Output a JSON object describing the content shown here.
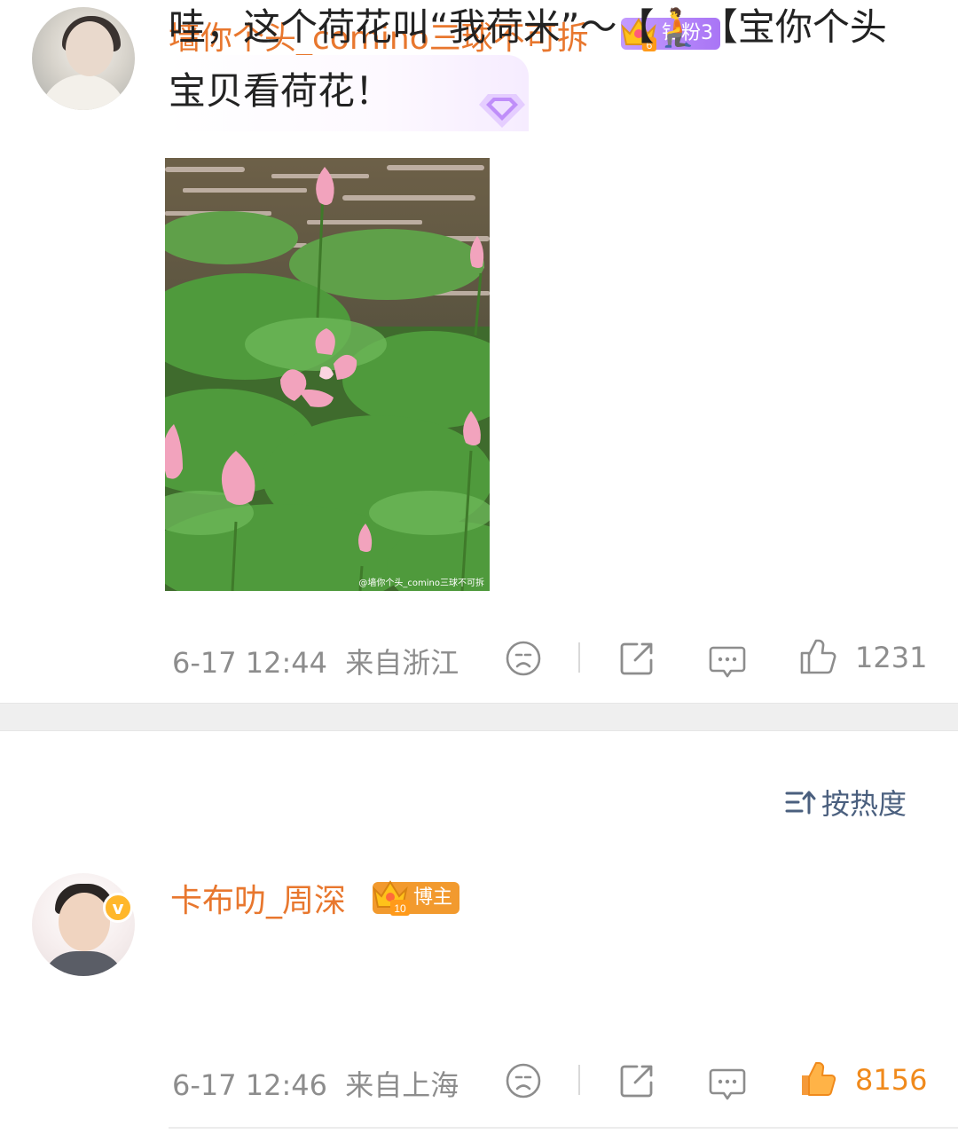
{
  "comments": [
    {
      "username": "墙你个头_comino三球不可拆",
      "badge": "钻粉3",
      "badge_level": "6",
      "text": "宝贝看荷花！",
      "image_watermark": "@墙你个头_comino三球不可拆",
      "timestamp": "6-17 12:44",
      "location": "来自浙江",
      "like_count": "1231",
      "liked": false
    },
    {
      "username": "卡布叻_周深",
      "badge": "博主",
      "badge_level": "10",
      "verified_mark": "v",
      "text": "哇，这个荷花叫“我荷米”～【🧎【宝你个头",
      "timestamp": "6-17 12:46",
      "location": "来自上海",
      "like_count": "8156",
      "liked": true
    }
  ],
  "sort": {
    "label": "按热度",
    "icon": "sort-icon"
  },
  "icons": {
    "sad_face": "sad-face-icon",
    "share": "share-icon",
    "comment": "comment-bubble-icon",
    "like": "thumbs-up-icon"
  },
  "colors": {
    "username": "#e8772e",
    "liked": "#f08a1c",
    "meta": "#8d8d8d",
    "sort": "#4a5f7e"
  }
}
